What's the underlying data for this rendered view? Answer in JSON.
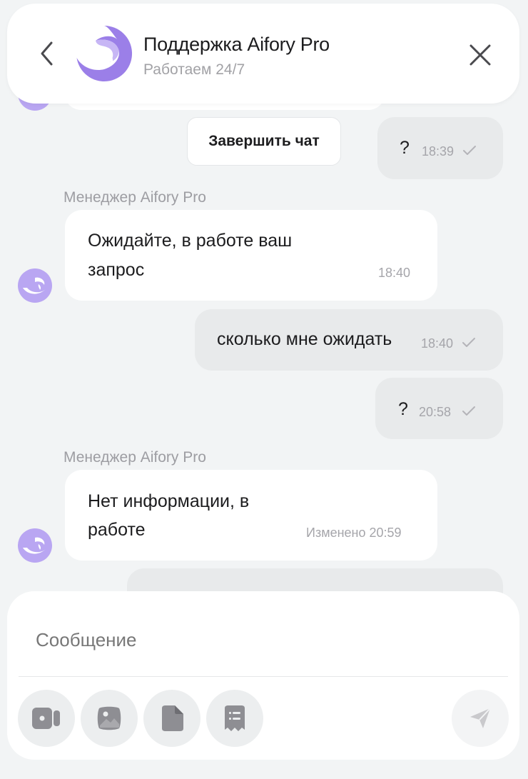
{
  "header": {
    "title": "Поддержка Aifory Pro",
    "subtitle": "Работаем 24/7"
  },
  "quick_actions": {
    "end_chat": "Завершить чат"
  },
  "messages": [
    {
      "direction": "out",
      "text": "?",
      "time": "18:39",
      "status": "sent"
    },
    {
      "direction": "in",
      "sender": "Менеджер Aifory Pro",
      "lines": [
        "Ожидайте, в работе ваш",
        "запрос"
      ],
      "time": "18:40"
    },
    {
      "direction": "out",
      "text": "сколько мне ожидать",
      "time": "18:40",
      "status": "sent"
    },
    {
      "direction": "out",
      "text": "?",
      "time": "20:58",
      "status": "sent"
    },
    {
      "direction": "in",
      "sender": "Менеджер Aifory Pro",
      "lines": [
        "Нет информации, в",
        "работе"
      ],
      "time": "Изменено 20:59"
    }
  ],
  "composer": {
    "placeholder": "Сообщение",
    "tools": [
      "video-icon",
      "image-icon",
      "document-icon",
      "template-icon"
    ],
    "send_icon": "send-icon"
  },
  "colors": {
    "brand_purple": "#9b7fe8",
    "brand_purple_light": "#c7b6f5",
    "outgoing_bubble": "#e8eaeb",
    "incoming_bubble": "#ffffff",
    "background": "#f2f4f5"
  }
}
